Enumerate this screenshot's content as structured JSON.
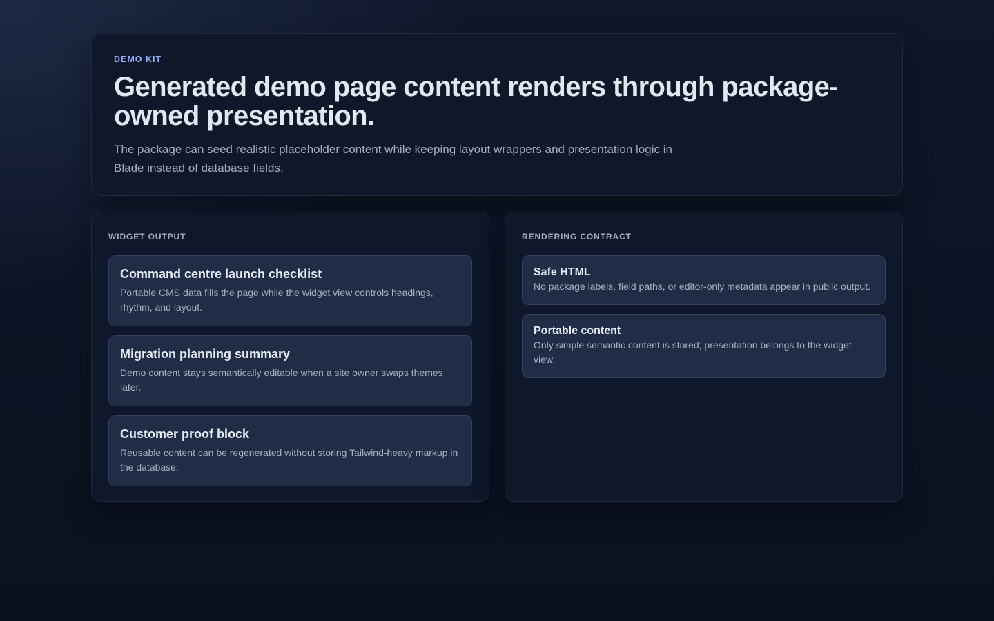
{
  "hero": {
    "eyebrow": "DEMO KIT",
    "title": "Generated demo page content renders through package-owned presentation.",
    "description": "The package can seed realistic placeholder content while keeping layout wrappers and presentation logic in Blade instead of database fields."
  },
  "widget_output": {
    "title": "WIDGET OUTPUT",
    "items": [
      {
        "title": "Command centre launch checklist",
        "description": "Portable CMS data fills the page while the widget view controls headings, rhythm, and layout."
      },
      {
        "title": "Migration planning summary",
        "description": "Demo content stays semantically editable when a site owner swaps themes later."
      },
      {
        "title": "Customer proof block",
        "description": "Reusable content can be regenerated without storing Tailwind-heavy markup in the database."
      }
    ]
  },
  "rendering_contract": {
    "title": "RENDERING CONTRACT",
    "items": [
      {
        "title": "Safe HTML",
        "description": "No package labels, field paths, or editor-only metadata appear in public output."
      },
      {
        "title": "Portable content",
        "description": "Only simple semantic content is stored; presentation belongs to the widget view."
      }
    ]
  },
  "colors": {
    "accent": "#93b4f8",
    "background": "#0f172a",
    "card": "#212d47"
  }
}
